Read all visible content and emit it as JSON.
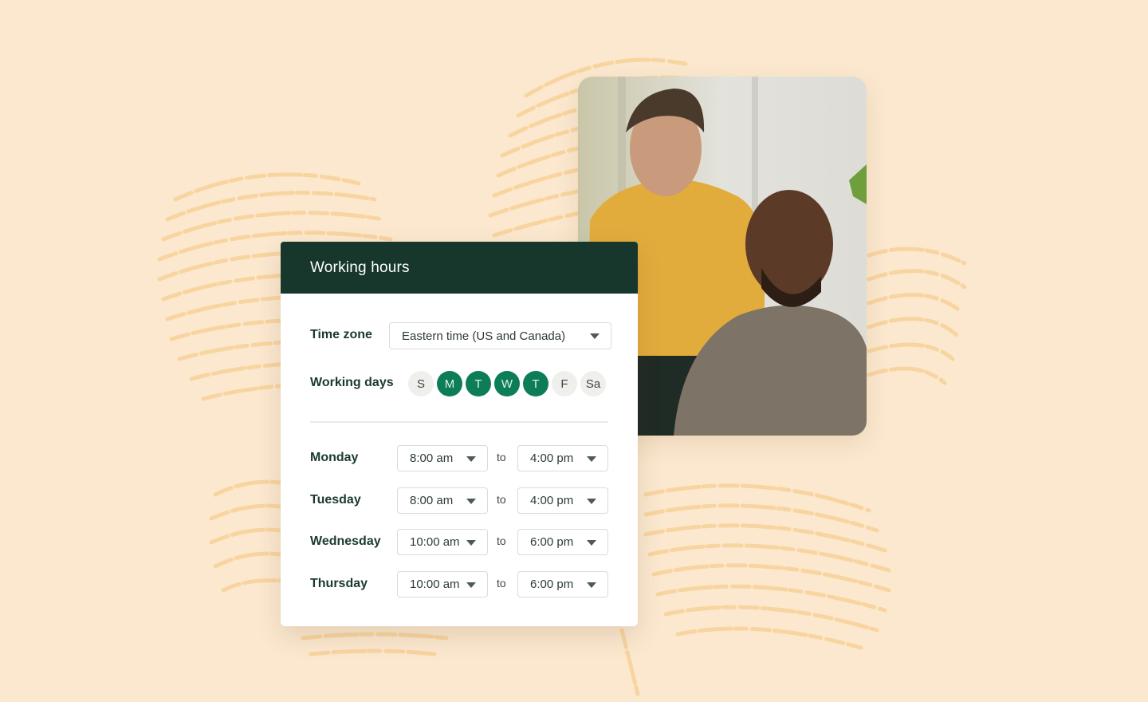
{
  "card": {
    "title": "Working hours",
    "timezone": {
      "label": "Time zone",
      "value": "Eastern time (US and Canada)"
    },
    "working_days": {
      "label": "Working days",
      "days": [
        {
          "label": "S",
          "selected": false
        },
        {
          "label": "M",
          "selected": true
        },
        {
          "label": "T",
          "selected": true
        },
        {
          "label": "W",
          "selected": true
        },
        {
          "label": "T",
          "selected": true
        },
        {
          "label": "F",
          "selected": false
        },
        {
          "label": "Sa",
          "selected": false
        }
      ]
    },
    "separator": "to",
    "schedule": [
      {
        "day": "Monday",
        "start": "8:00 am",
        "end": "4:00 pm"
      },
      {
        "day": "Tuesday",
        "start": "8:00 am",
        "end": "4:00 pm"
      },
      {
        "day": "Wednesday",
        "start": "10:00 am",
        "end": "6:00 pm"
      },
      {
        "day": "Thursday",
        "start": "10:00 am",
        "end": "6:00 pm"
      }
    ]
  },
  "photo": {
    "description": "Two men looking at a screen in an office"
  },
  "colors": {
    "background": "#fbe8cf",
    "texture": "#f8cf8f",
    "header": "#17372c",
    "selected_day": "#0c7d57",
    "unselected_day": "#efefec"
  },
  "icons": {
    "dropdown": "caret-down-icon"
  }
}
